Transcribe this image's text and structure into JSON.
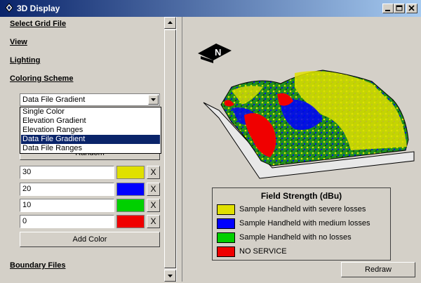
{
  "window": {
    "title": "3D Display"
  },
  "sections": {
    "select_grid_file": "Select Grid File",
    "view": "View",
    "lighting": "Lighting",
    "coloring_scheme": "Coloring Scheme",
    "boundary_files": "Boundary Files"
  },
  "coloring": {
    "selected": "Data File Gradient",
    "options": [
      "Single Color",
      "Elevation Gradient",
      "Elevation Ranges",
      "Data File Gradient",
      "Data File Ranges"
    ],
    "hidden_button_label": "Random",
    "rows": [
      {
        "value": "30",
        "color": "#e0e000"
      },
      {
        "value": "20",
        "color": "#0000ff"
      },
      {
        "value": "10",
        "color": "#00d000"
      },
      {
        "value": "0",
        "color": "#f00000"
      }
    ],
    "remove_glyph": "X",
    "add_color_label": "Add Color"
  },
  "legend": {
    "title": "Field Strength (dBu)",
    "items": [
      {
        "label": "Sample Handheld with severe losses",
        "color": "#e0e000"
      },
      {
        "label": "Sample Handheld with medium losses",
        "color": "#0000ff"
      },
      {
        "label": "Sample Handheld with no losses",
        "color": "#00d000"
      },
      {
        "label": "NO SERVICE",
        "color": "#f00000"
      }
    ]
  },
  "compass": {
    "label": "N"
  },
  "redraw_label": "Redraw"
}
